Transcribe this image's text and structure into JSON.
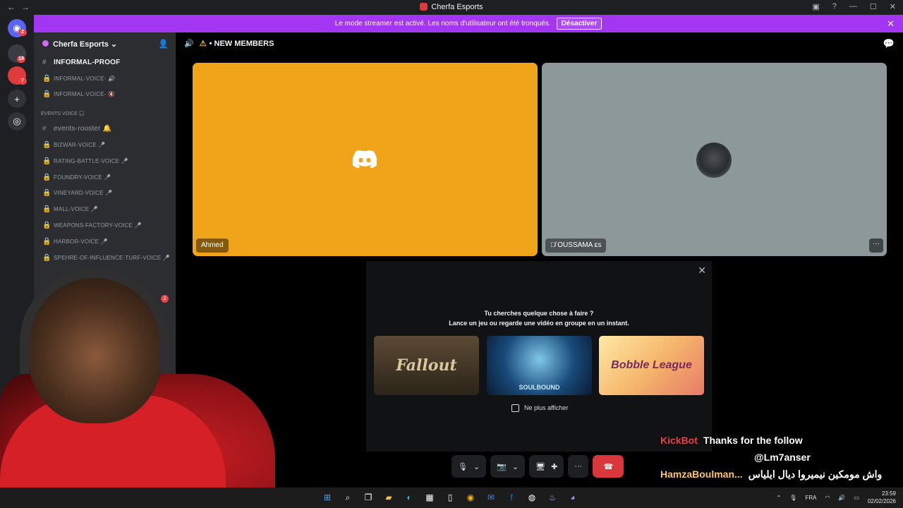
{
  "window": {
    "title": "Cherfa Esports",
    "back": "←",
    "forward": "→"
  },
  "banner": {
    "text": "Le mode streamer est activé. Les noms d'utilisateur ont été tronqués.",
    "button": "Désactiver"
  },
  "rail": {
    "badges": [
      "2",
      "19",
      "7"
    ]
  },
  "sidebar": {
    "server_name": "Cherfa Esports",
    "channels": [
      {
        "label": "INFORMAL-PROOF",
        "type": "text",
        "active": true
      },
      {
        "label": "INFORMAL-VOICE- 🔊",
        "type": "voice"
      },
      {
        "label": "INFORMAL-VOICE- 🔇",
        "type": "voice"
      }
    ],
    "category": "EVENTS VOICE 🎧",
    "event_channels": [
      {
        "label": "events-rooster 🔔",
        "type": "text"
      },
      {
        "label": "BIZWAR-VOICE 🎤",
        "type": "voice"
      },
      {
        "label": "RATING-BATTLE-VOICE 🎤",
        "type": "voice"
      },
      {
        "label": "FOUNDRY-VOICE 🎤",
        "type": "voice"
      },
      {
        "label": "VINEYARD-VOICE 🎤",
        "type": "voice"
      },
      {
        "label": "MALL-VOICE 🎤",
        "type": "voice"
      },
      {
        "label": "WEAPONS-FACTORY-VOICE 🎤",
        "type": "voice"
      },
      {
        "label": "HARBOR-VOICE 🎤",
        "type": "voice"
      },
      {
        "label": "SPEHRE-OF-INFLUENCE-TURF-VOICE 🎤",
        "type": "voice"
      }
    ],
    "badge": "2"
  },
  "main": {
    "channel_title": "NEW MEMBERS",
    "tiles": [
      {
        "name": "Ahmed",
        "color": "#f0a41a"
      },
      {
        "name": "OUSSAMA ᴇs",
        "color": "#8c9899"
      }
    ],
    "activity": {
      "title": "Tu cherches quelque chose à faire ?",
      "subtitle": "Lance un jeu ou regarde une vidéo en groupe en un instant.",
      "games": [
        "Fallout",
        "SOULBOUND",
        "Bobble League"
      ],
      "checkbox_label": "Ne plus afficher"
    }
  },
  "chat_overlay": [
    {
      "user": "KickBot",
      "message": "Thanks for the follow"
    },
    {
      "user": "",
      "message": "@Lm7anser"
    },
    {
      "user": "HamzaBoulman...",
      "message": "واش مومكين نيميروا ديال ايلياس"
    }
  ],
  "taskbar": {
    "lang": "FRA",
    "time": "23:59",
    "date": "02/02/2026"
  },
  "colors": {
    "accent": "#a336f2",
    "hangup": "#da373c",
    "tile1": "#f0a41a",
    "tile2": "#8c9899"
  }
}
